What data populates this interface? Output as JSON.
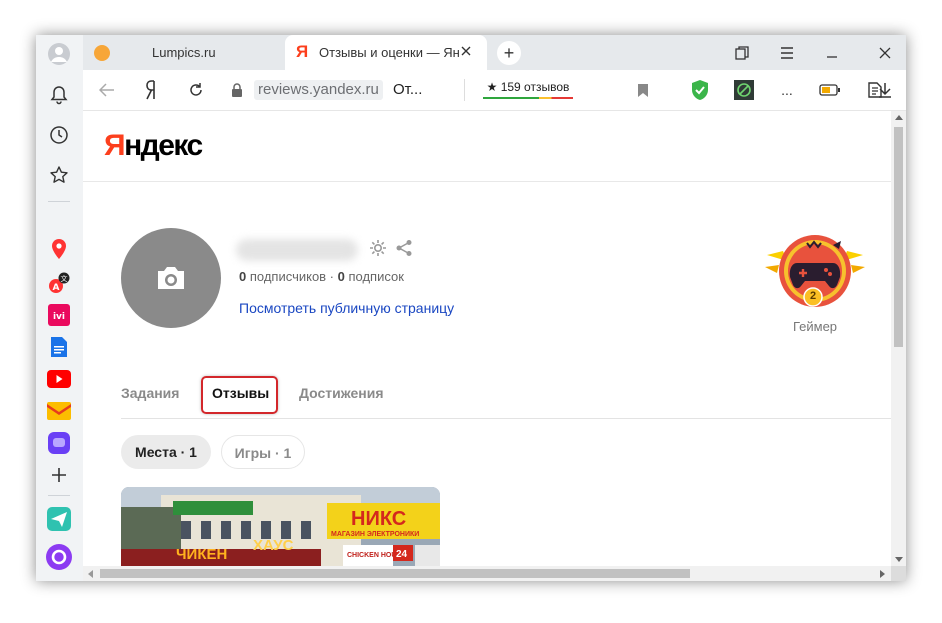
{
  "browser": {
    "tabs": [
      {
        "title": "Lumpics.ru",
        "active": false
      },
      {
        "title": "Отзывы и оценки — Ян",
        "active": true
      }
    ],
    "new_tab_symbol": "+",
    "address": {
      "host": "reviews.yandex.ru",
      "title": "От..."
    },
    "rating_badge": {
      "text": "★ 159 отзывов"
    },
    "ext_more": "...",
    "accent_color": "#fc3f1d"
  },
  "sidebar": {
    "icons": [
      "bell-icon",
      "history-icon",
      "star-icon",
      "maps-icon",
      "translate-icon",
      "ivi-icon",
      "docs-icon",
      "youtube-icon",
      "mail-icon",
      "messenger-icon",
      "add-icon",
      "send-icon",
      "alice-icon"
    ]
  },
  "page": {
    "logo": {
      "first": "Я",
      "rest": "ндекс"
    },
    "profile": {
      "subs_count_a": "0",
      "subs_label_a": " подписчиков · ",
      "subs_count_b": "0",
      "subs_label_b": " подписок",
      "public_link": "Посмотреть публичную страницу"
    },
    "achievement": {
      "level": "2",
      "caption": "Геймер"
    },
    "tabs": [
      {
        "label": "Задания",
        "active": false
      },
      {
        "label": "Отзывы",
        "active": true
      },
      {
        "label": "Достижения",
        "active": false
      }
    ],
    "filters": [
      {
        "label": "Места · 1",
        "active": true
      },
      {
        "label": "Игры · 1",
        "active": false
      }
    ],
    "photo_signs": {
      "shop_name": "НИКС",
      "shop_sub": "МАГАЗИН ЭЛЕКТРОНИКИ",
      "left_sign": "ЧИКЕН",
      "mid_sign": "ХАУС",
      "box": "24",
      "chicken": "CHICKEN HOUSE"
    }
  }
}
